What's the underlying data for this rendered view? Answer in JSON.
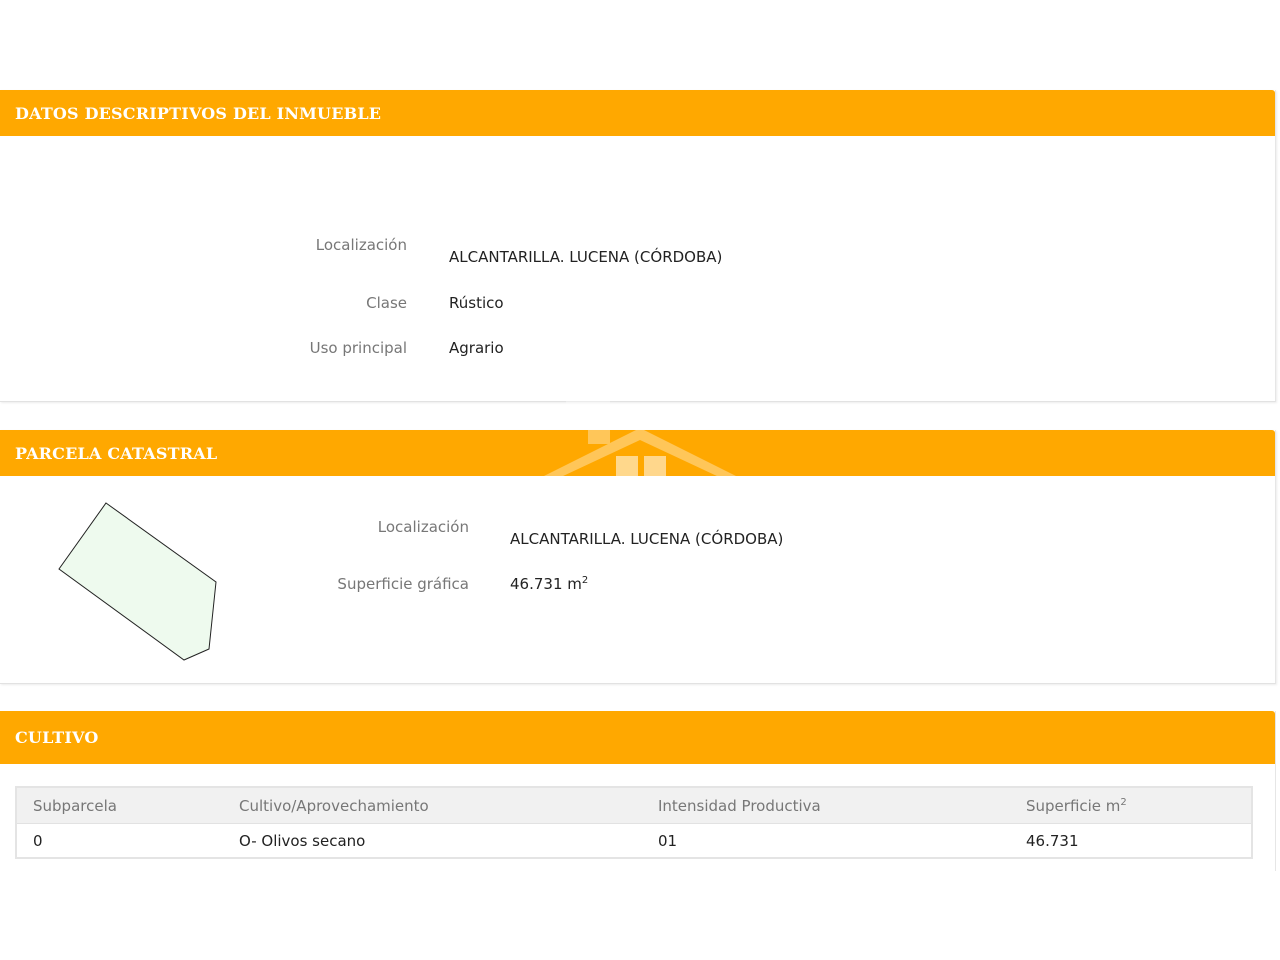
{
  "descriptive": {
    "title": "DATOS DESCRIPTIVOS DEL INMUEBLE",
    "localizacion_label": "Localización",
    "localizacion_value": "ALCANTARILLA. LUCENA (CÓRDOBA)",
    "clase_label": "Clase",
    "clase_value": "Rústico",
    "uso_label": "Uso principal",
    "uso_value": "Agrario"
  },
  "parcel": {
    "title": "PARCELA CATASTRAL",
    "localizacion_label": "Localización",
    "localizacion_value": "ALCANTARILLA. LUCENA (CÓRDOBA)",
    "superficie_label": "Superficie gráfica",
    "superficie_value": "46.731 m",
    "superficie_sup": "2"
  },
  "cultivo": {
    "title": "CULTIVO",
    "headers": {
      "subparcela": "Subparcela",
      "cultivo": "Cultivo/Aprovechamiento",
      "intensidad": "Intensidad Productiva",
      "superficie": "Superficie m",
      "superficie_sup": "2"
    },
    "rows": [
      {
        "subparcela": "0",
        "cultivo": "O- Olivos secano",
        "intensidad": "01",
        "superficie": "46.731"
      }
    ]
  },
  "colors": {
    "header_orange": "#ffa800",
    "parcel_fill": "#eefaee"
  },
  "icons": {
    "watermark": "house-logo-watermark",
    "parcel_shape": "parcel-outline"
  }
}
